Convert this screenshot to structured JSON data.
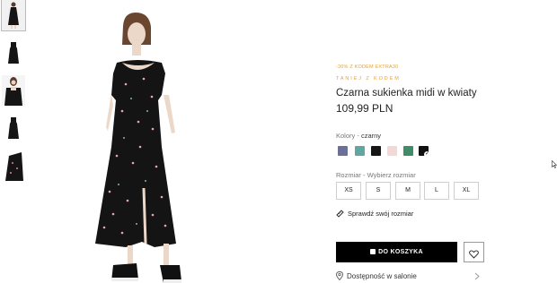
{
  "thumbnails": [
    {
      "name": "front-full",
      "active": true
    },
    {
      "name": "front-dress"
    },
    {
      "name": "detail-top"
    },
    {
      "name": "back-dress"
    },
    {
      "name": "fabric-detail"
    }
  ],
  "product": {
    "promo": "-30% Z KODEM EXTRA30",
    "promo_sub": "TANIEJ Z KODEM",
    "title": "Czarna sukienka midi w kwiaty",
    "price": "109,99 PLN"
  },
  "colors": {
    "label": "Kolory",
    "separator": " - ",
    "selected": "czarny",
    "swatches": [
      {
        "color": "#6b6f9a",
        "pattern": "floral-purple"
      },
      {
        "color": "#5fa7a0",
        "pattern": "floral-green"
      },
      {
        "color": "#151515",
        "pattern": "solid-black"
      },
      {
        "color": "#f3d8d8",
        "pattern": "floral-pink"
      },
      {
        "color": "#3f8c66",
        "pattern": "floral-green-dark"
      },
      {
        "color": "#111111",
        "pattern": "floral-black",
        "selected": true
      }
    ]
  },
  "sizes": {
    "label": "Rozmiar",
    "separator": " - ",
    "prompt": "Wybierz rozmiar",
    "options": [
      "XS",
      "S",
      "M",
      "L",
      "XL"
    ]
  },
  "size_guide": "Sprawdź swój rozmiar",
  "cart_button": "DO KOSZYKA",
  "availability": "Dostępność w salonie",
  "accent_color": "#e8a233"
}
